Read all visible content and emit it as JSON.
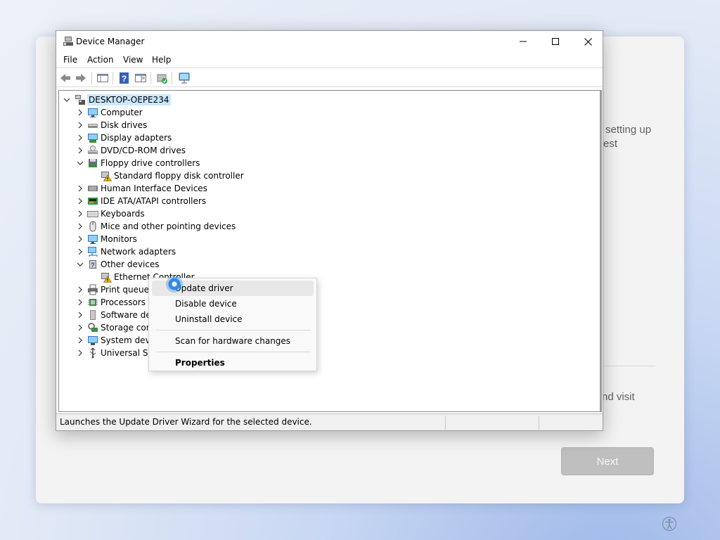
{
  "window": {
    "title": "Device Manager",
    "menu": [
      "File",
      "Action",
      "View",
      "Help"
    ]
  },
  "tree": {
    "root": "DESKTOP-OEPE234",
    "items": [
      {
        "label": "Computer",
        "icon": "monitor-icon",
        "expanded": false
      },
      {
        "label": "Disk drives",
        "icon": "disk-drive-icon",
        "expanded": false
      },
      {
        "label": "Display adapters",
        "icon": "display-adapter-icon",
        "expanded": false
      },
      {
        "label": "DVD/CD-ROM drives",
        "icon": "dvd-drive-icon",
        "expanded": false
      },
      {
        "label": "Floppy drive controllers",
        "icon": "floppy-controller-icon",
        "expanded": true
      },
      {
        "label": "Standard floppy disk controller",
        "icon": "warning-device-icon",
        "child": true
      },
      {
        "label": "Human Interface Devices",
        "icon": "hid-icon",
        "expanded": false
      },
      {
        "label": "IDE ATA/ATAPI controllers",
        "icon": "ide-controller-icon",
        "expanded": false
      },
      {
        "label": "Keyboards",
        "icon": "keyboard-icon",
        "expanded": false
      },
      {
        "label": "Mice and other pointing devices",
        "icon": "mouse-icon",
        "expanded": false
      },
      {
        "label": "Monitors",
        "icon": "monitor-icon",
        "expanded": false
      },
      {
        "label": "Network adapters",
        "icon": "network-adapter-icon",
        "expanded": false
      },
      {
        "label": "Other devices",
        "icon": "unknown-device-icon",
        "expanded": true
      },
      {
        "label": "Ethernet Controller",
        "icon": "warning-device-icon",
        "child": true
      },
      {
        "label": "Print queues",
        "icon": "printer-icon",
        "expanded": false
      },
      {
        "label": "Processors",
        "icon": "processor-icon",
        "expanded": false
      },
      {
        "label": "Software dev",
        "icon": "software-device-icon",
        "expanded": false
      },
      {
        "label": "Storage cont",
        "icon": "storage-controller-icon",
        "expanded": false
      },
      {
        "label": "System devic",
        "icon": "system-device-icon",
        "expanded": false
      },
      {
        "label": "Universal Se",
        "icon": "usb-icon",
        "expanded": false
      }
    ]
  },
  "context_menu": {
    "items": [
      "Update driver",
      "Disable device",
      "Uninstall device",
      "Scan for hardware changes",
      "Properties"
    ]
  },
  "status": {
    "text": "Launches the Update Driver Wizard for the selected device."
  },
  "oobe": {
    "line1": "setting up",
    "line2": "est",
    "line3": "nd visit",
    "next_label": "Next"
  },
  "colors": {
    "selection": "#cce8ff",
    "cursor": "#2e8be6",
    "next_button": "#bfbfbf"
  }
}
